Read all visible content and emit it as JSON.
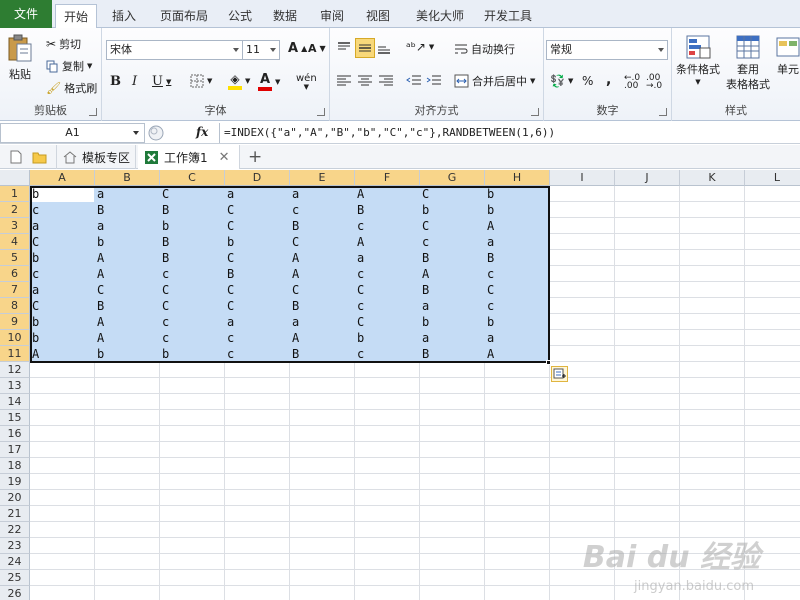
{
  "ribbon_tabs": [
    "文件",
    "开始",
    "插入",
    "页面布局",
    "公式",
    "数据",
    "审阅",
    "视图",
    "美化大师",
    "开发工具"
  ],
  "clipboard": {
    "paste": "粘贴",
    "cut": "剪切",
    "copy": "复制",
    "format_painter": "格式刷",
    "label": "剪贴板"
  },
  "font": {
    "name": "宋体",
    "size": "11",
    "grow": "A",
    "shrink": "A",
    "bold": "B",
    "italic": "I",
    "underline": "U",
    "color_a": "A",
    "phonetic": "wén",
    "label": "字体"
  },
  "alignment": {
    "wrap": "自动换行",
    "merge": "合并后居中",
    "label": "对齐方式"
  },
  "number": {
    "format": "常规",
    "percent": "%",
    "comma": ",",
    "label": "数字"
  },
  "styles": {
    "conditional": "条件格式",
    "table_line1": "套用",
    "table_line2": "表格格式",
    "cell_styles": "单元",
    "label": "样式"
  },
  "formula_bar": {
    "name_box": "A1",
    "fx": "fx",
    "formula": "=INDEX({\"a\",\"A\",\"B\",\"b\",\"C\",\"c\"},RANDBETWEEN(1,6))"
  },
  "doc_tabs": {
    "template": "模板专区",
    "workbook": "工作簿1",
    "add": "+"
  },
  "columns": [
    "A",
    "B",
    "C",
    "D",
    "E",
    "F",
    "G",
    "H",
    "I",
    "J",
    "K",
    "L"
  ],
  "rows": [
    "1",
    "2",
    "3",
    "4",
    "5",
    "6",
    "7",
    "8",
    "9",
    "10",
    "11",
    "12",
    "13",
    "14",
    "15",
    "16",
    "17",
    "18",
    "19",
    "20",
    "21",
    "22",
    "23",
    "24",
    "25",
    "26"
  ],
  "cells": [
    [
      "b",
      "a",
      "C",
      "a",
      "a",
      "A",
      "C",
      "b"
    ],
    [
      "c",
      "B",
      "B",
      "C",
      "c",
      "B",
      "b",
      "b"
    ],
    [
      "a",
      "a",
      "b",
      "C",
      "B",
      "c",
      "C",
      "A"
    ],
    [
      "C",
      "b",
      "B",
      "b",
      "C",
      "A",
      "c",
      "a"
    ],
    [
      "b",
      "A",
      "B",
      "C",
      "A",
      "a",
      "B",
      "B"
    ],
    [
      "c",
      "A",
      "c",
      "B",
      "A",
      "c",
      "A",
      "c"
    ],
    [
      "a",
      "C",
      "C",
      "C",
      "C",
      "C",
      "B",
      "C"
    ],
    [
      "C",
      "B",
      "C",
      "C",
      "B",
      "c",
      "a",
      "c"
    ],
    [
      "b",
      "A",
      "c",
      "a",
      "a",
      "C",
      "b",
      "b"
    ],
    [
      "b",
      "A",
      "c",
      "c",
      "A",
      "b",
      "a",
      "a"
    ],
    [
      "A",
      "b",
      "b",
      "c",
      "B",
      "c",
      "B",
      "A"
    ]
  ],
  "watermark": {
    "brand": "Bai du 经验",
    "url": "jingyan.baidu.com"
  },
  "colors": {
    "file_tab": "#2e7d32",
    "selection": "#c5dcf5",
    "header_selected": "#f8d58a"
  }
}
